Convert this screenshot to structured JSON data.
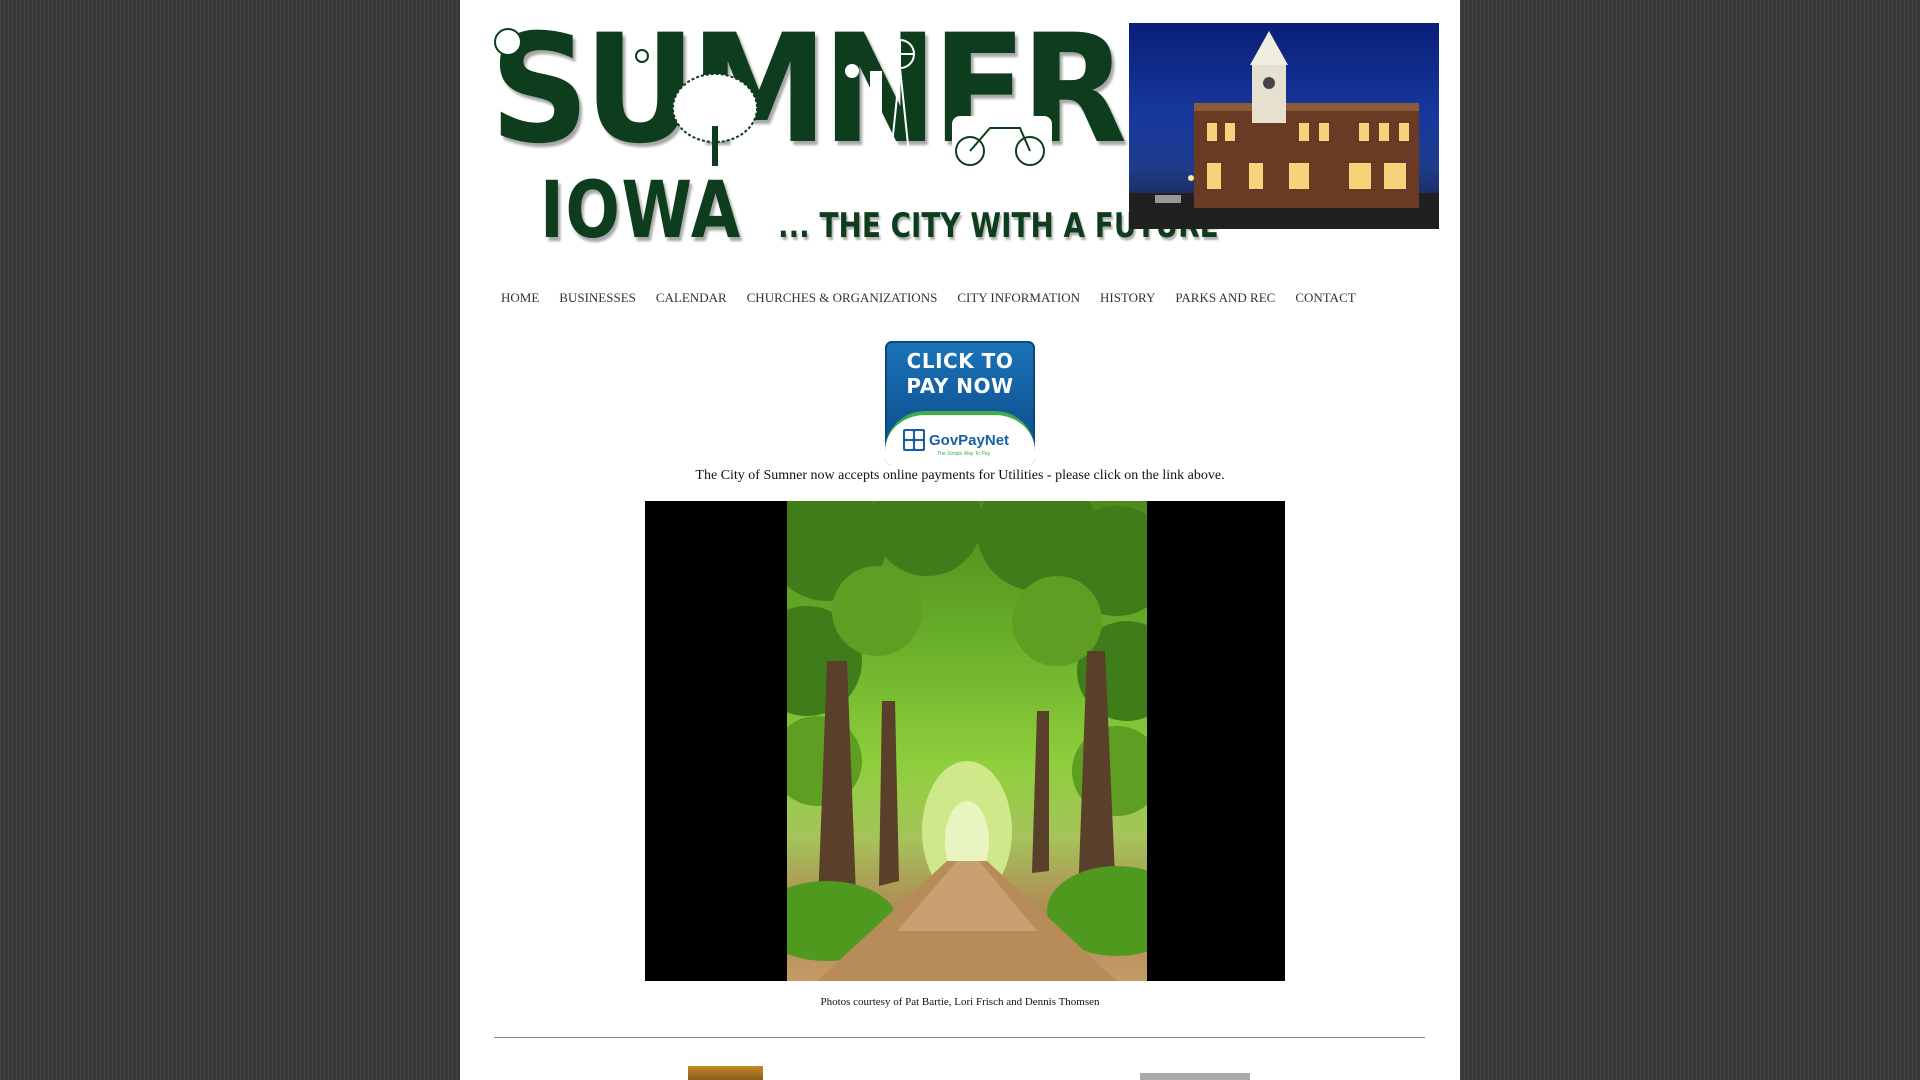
{
  "header": {
    "logo_main": "SUMNER",
    "logo_sub": "IOWA",
    "logo_tagline": "... THE CITY WITH A FUTURE"
  },
  "nav": {
    "items": [
      {
        "label": "HOME"
      },
      {
        "label": "BUSINESSES"
      },
      {
        "label": "CALENDAR"
      },
      {
        "label": "CHURCHES & ORGANIZATIONS"
      },
      {
        "label": "CITY INFORMATION"
      },
      {
        "label": "HISTORY"
      },
      {
        "label": "PARKS AND REC"
      },
      {
        "label": "CONTACT"
      }
    ]
  },
  "payment": {
    "button_line1": "CLICK TO",
    "button_line2": "PAY NOW",
    "provider_name": "GovPayNet",
    "provider_tagline": "The Simple Way To Pay",
    "caption": "The City of Sumner now accepts online payments for Utilities - please click on the link above."
  },
  "slideshow": {
    "credit": "Photos courtesy of Pat Bartie, Lori Frisch and Dennis Thomsen"
  },
  "colors": {
    "logo_green": "#0d3d1c",
    "page_background": "#3b3b3b",
    "pay_blue": "#125a9c",
    "pay_green": "#3fae49"
  }
}
